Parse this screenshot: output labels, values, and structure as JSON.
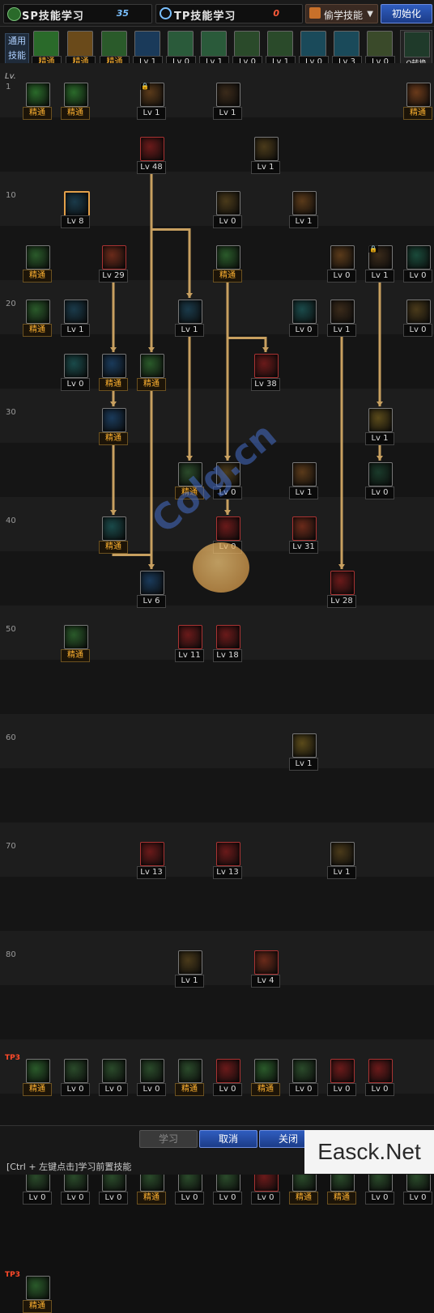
{
  "header": {
    "sp_label": "SP技能学习",
    "sp_value": "35",
    "tp_label": "TP技能学习",
    "tp_value": "0",
    "select_label": "偷学技能",
    "reset_label": "初始化"
  },
  "favorites": {
    "label": "通用技能",
    "items": [
      {
        "cap": "精通",
        "c": "#2a6a2a"
      },
      {
        "cap": "精通",
        "c": "#6a4a1a"
      },
      {
        "cap": "精通",
        "c": "#2a5a2a"
      },
      {
        "cap": "Lv 1",
        "c": "#1a3a5a"
      },
      {
        "cap": "Lv 0",
        "c": "#2a5a3a"
      },
      {
        "cap": "Lv 1",
        "c": "#2a5a3a"
      },
      {
        "cap": "Lv 0",
        "c": "#2a4a2a"
      },
      {
        "cap": "Lv 1",
        "c": "#2a4a2a"
      },
      {
        "cap": "Lv 0",
        "c": "#1a4a5a"
      },
      {
        "cap": "Lv 3",
        "c": "#1a4a5a"
      },
      {
        "cap": "Lv 0",
        "c": "#3a4a2a"
      }
    ],
    "swap_label": "Q转换"
  },
  "grid": {
    "lv_header": "Lv.",
    "level_labels": [
      {
        "t": "1",
        "row": 0
      },
      {
        "t": "10",
        "row": 2
      },
      {
        "t": "20",
        "row": 4
      },
      {
        "t": "30",
        "row": 6
      },
      {
        "t": "40",
        "row": 8
      },
      {
        "t": "50",
        "row": 10
      },
      {
        "t": "60",
        "row": 12
      },
      {
        "t": "70",
        "row": 14
      },
      {
        "t": "80",
        "row": 16
      }
    ],
    "tags": [
      {
        "t": "TP3",
        "row": 18
      },
      {
        "t": "TP3",
        "row": 20
      },
      {
        "t": "TP3",
        "row": 22
      }
    ],
    "skills": [
      {
        "col": 0,
        "row": 0,
        "cap": "精通",
        "c": "#2a6a2a"
      },
      {
        "col": 1,
        "row": 0,
        "cap": "精通",
        "c": "#2a6a2a"
      },
      {
        "col": 3,
        "row": 0,
        "cap": "Lv 1",
        "c": "#5a3a1a",
        "lock": true
      },
      {
        "col": 5,
        "row": 0,
        "cap": "Lv 1",
        "c": "#3a2a1a"
      },
      {
        "col": 10,
        "row": 0,
        "cap": "精通",
        "c": "#6a3a1a"
      },
      {
        "col": 3,
        "row": 1,
        "cap": "Lv 48",
        "c": "#6a1a1a",
        "red": true
      },
      {
        "col": 6,
        "row": 1,
        "cap": "Lv 1",
        "c": "#4a3a1a"
      },
      {
        "col": 1,
        "row": 2,
        "cap": "Lv 8",
        "c": "#1a3a4a",
        "sel": true
      },
      {
        "col": 5,
        "row": 2,
        "cap": "Lv 0",
        "c": "#4a3a1a"
      },
      {
        "col": 7,
        "row": 2,
        "cap": "Lv 1",
        "c": "#5a3a1a"
      },
      {
        "col": 0,
        "row": 3,
        "cap": "精通",
        "c": "#2a5a2a"
      },
      {
        "col": 2,
        "row": 3,
        "cap": "Lv 29",
        "c": "#6a2a1a",
        "red": true
      },
      {
        "col": 5,
        "row": 3,
        "cap": "精通",
        "c": "#2a5a2a"
      },
      {
        "col": 8,
        "row": 3,
        "cap": "Lv 0",
        "c": "#5a3a1a"
      },
      {
        "col": 9,
        "row": 3,
        "cap": "Lv 1",
        "c": "#3a2a1a",
        "lock": true
      },
      {
        "col": 10,
        "row": 3,
        "cap": "Lv 0",
        "c": "#1a4a3a"
      },
      {
        "col": 0,
        "row": 4,
        "cap": "精通",
        "c": "#2a5a2a"
      },
      {
        "col": 1,
        "row": 4,
        "cap": "Lv 1",
        "c": "#1a3a4a"
      },
      {
        "col": 4,
        "row": 4,
        "cap": "Lv 1",
        "c": "#1a3a4a"
      },
      {
        "col": 7,
        "row": 4,
        "cap": "Lv 0",
        "c": "#1a4a4a"
      },
      {
        "col": 8,
        "row": 4,
        "cap": "Lv 1",
        "c": "#3a2a1a"
      },
      {
        "col": 10,
        "row": 4,
        "cap": "Lv 0",
        "c": "#4a3a1a"
      },
      {
        "col": 1,
        "row": 5,
        "cap": "Lv 0",
        "c": "#1a4a4a"
      },
      {
        "col": 2,
        "row": 5,
        "cap": "精通",
        "c": "#1a3a5a"
      },
      {
        "col": 3,
        "row": 5,
        "cap": "精通",
        "c": "#2a5a2a"
      },
      {
        "col": 6,
        "row": 5,
        "cap": "Lv 38",
        "c": "#6a1a1a",
        "red": true
      },
      {
        "col": 2,
        "row": 6,
        "cap": "精通",
        "c": "#1a3a5a"
      },
      {
        "col": 9,
        "row": 6,
        "cap": "Lv 1",
        "c": "#5a4a1a"
      },
      {
        "col": 4,
        "row": 7,
        "cap": "精通",
        "c": "#2a4a2a"
      },
      {
        "col": 5,
        "row": 7,
        "cap": "Lv 0",
        "c": "#4a3a1a"
      },
      {
        "col": 7,
        "row": 7,
        "cap": "Lv 1",
        "c": "#5a3a1a"
      },
      {
        "col": 9,
        "row": 7,
        "cap": "Lv 0",
        "c": "#1a3a2a"
      },
      {
        "col": 2,
        "row": 8,
        "cap": "精通",
        "c": "#1a4a4a"
      },
      {
        "col": 5,
        "row": 8,
        "cap": "Lv 0",
        "c": "#6a1a1a",
        "red": true
      },
      {
        "col": 7,
        "row": 8,
        "cap": "Lv 31",
        "c": "#6a2a1a",
        "red": true
      },
      {
        "col": 3,
        "row": 9,
        "cap": "Lv 6",
        "c": "#1a3a5a"
      },
      {
        "col": 8,
        "row": 9,
        "cap": "Lv 28",
        "c": "#6a1a1a",
        "red": true
      },
      {
        "col": 1,
        "row": 10,
        "cap": "精通",
        "c": "#2a5a2a"
      },
      {
        "col": 4,
        "row": 10,
        "cap": "Lv 11",
        "c": "#6a1a1a",
        "red": true
      },
      {
        "col": 5,
        "row": 10,
        "cap": "Lv 18",
        "c": "#6a1a1a",
        "red": true
      },
      {
        "col": 7,
        "row": 12,
        "cap": "Lv 1",
        "c": "#5a4a1a"
      },
      {
        "col": 3,
        "row": 14,
        "cap": "Lv 13",
        "c": "#6a1a1a",
        "red": true
      },
      {
        "col": 5,
        "row": 14,
        "cap": "Lv 13",
        "c": "#6a1a1a",
        "red": true
      },
      {
        "col": 8,
        "row": 14,
        "cap": "Lv 1",
        "c": "#4a3a1a"
      },
      {
        "col": 4,
        "row": 16,
        "cap": "Lv 1",
        "c": "#4a3a1a"
      },
      {
        "col": 6,
        "row": 16,
        "cap": "Lv 4",
        "c": "#6a2a1a",
        "red": true
      },
      {
        "col": 0,
        "row": 18,
        "cap": "精通",
        "c": "#2a5a2a"
      },
      {
        "col": 1,
        "row": 18,
        "cap": "Lv 0",
        "c": "#2a4a2a"
      },
      {
        "col": 2,
        "row": 18,
        "cap": "Lv 0",
        "c": "#2a4a2a"
      },
      {
        "col": 3,
        "row": 18,
        "cap": "Lv 0",
        "c": "#2a4a2a"
      },
      {
        "col": 4,
        "row": 18,
        "cap": "精通",
        "c": "#2a4a2a"
      },
      {
        "col": 5,
        "row": 18,
        "cap": "Lv 0",
        "c": "#6a1a1a",
        "red": true
      },
      {
        "col": 6,
        "row": 18,
        "cap": "精通",
        "c": "#2a5a2a"
      },
      {
        "col": 7,
        "row": 18,
        "cap": "Lv 0",
        "c": "#2a4a2a"
      },
      {
        "col": 8,
        "row": 18,
        "cap": "Lv 0",
        "c": "#6a1a1a",
        "red": true
      },
      {
        "col": 9,
        "row": 18,
        "cap": "Lv 0",
        "c": "#6a1a1a",
        "red": true
      },
      {
        "col": 0,
        "row": 20,
        "cap": "Lv 0",
        "c": "#2a4a2a"
      },
      {
        "col": 1,
        "row": 20,
        "cap": "Lv 0",
        "c": "#2a4a2a"
      },
      {
        "col": 2,
        "row": 20,
        "cap": "Lv 0",
        "c": "#2a4a2a"
      },
      {
        "col": 3,
        "row": 20,
        "cap": "精通",
        "c": "#2a4a2a"
      },
      {
        "col": 4,
        "row": 20,
        "cap": "Lv 0",
        "c": "#2a4a2a"
      },
      {
        "col": 5,
        "row": 20,
        "cap": "Lv 0",
        "c": "#2a4a2a"
      },
      {
        "col": 6,
        "row": 20,
        "cap": "Lv 0",
        "c": "#6a1a1a",
        "red": true
      },
      {
        "col": 7,
        "row": 20,
        "cap": "精通",
        "c": "#2a4a2a"
      },
      {
        "col": 8,
        "row": 20,
        "cap": "精通",
        "c": "#2a4a2a"
      },
      {
        "col": 9,
        "row": 20,
        "cap": "Lv 0",
        "c": "#2a4a2a"
      },
      {
        "col": 10,
        "row": 20,
        "cap": "Lv 0",
        "c": "#2a4a2a"
      },
      {
        "col": 0,
        "row": 22,
        "cap": "精通",
        "c": "#2a5a2a"
      }
    ],
    "links": [
      [
        3,
        1,
        4,
        4
      ],
      [
        3,
        1,
        3,
        5
      ],
      [
        3,
        5,
        3,
        9
      ],
      [
        2,
        3,
        2,
        5
      ],
      [
        2,
        5,
        2,
        6
      ],
      [
        2,
        6,
        2,
        8
      ],
      [
        2,
        8,
        3,
        9
      ],
      [
        5,
        3,
        5,
        7
      ],
      [
        5,
        4,
        6,
        5
      ],
      [
        4,
        4,
        4,
        7
      ],
      [
        9,
        3,
        9,
        6
      ],
      [
        9,
        6,
        9,
        7
      ],
      [
        8,
        4,
        8,
        9
      ],
      [
        5,
        7,
        5,
        8
      ]
    ]
  },
  "footer": {
    "learn_label": "学习",
    "cancel_label": "取消",
    "close_label": "关闭",
    "hint": "[Ctrl + 左键点击]学习前置技能"
  },
  "watermark": {
    "left": "Colg.cn",
    "right": "Easck.Net"
  },
  "colors": {
    "accent_blue": "#2f5dbf",
    "master_gold": "#ffb230",
    "line_gold": "#c8a060",
    "tp_red": "#ff4a2a"
  }
}
